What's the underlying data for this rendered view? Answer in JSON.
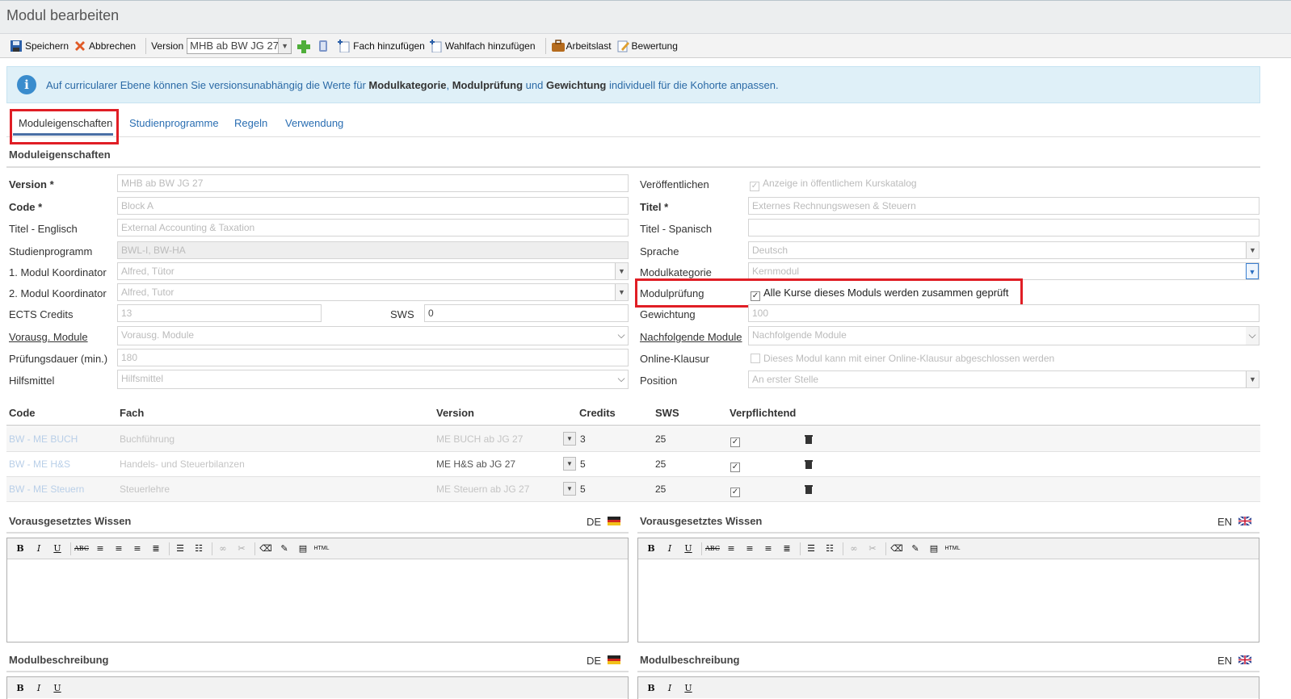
{
  "title": "Modul bearbeiten",
  "toolbar": {
    "save": "Speichern",
    "cancel": "Abbrechen",
    "version_label": "Version",
    "version_value": "MHB ab BW JG 27 √",
    "add_subject": "Fach hinzufügen",
    "add_elective": "Wahlfach hinzufügen",
    "workload": "Arbeitslast",
    "rating": "Bewertung"
  },
  "info": {
    "pre": "Auf curricularer Ebene können Sie versionsunabhängig die Werte für ",
    "b1": "Modulkategorie",
    "mid1": ", ",
    "b2": "Modulprüfung",
    "mid2": " und ",
    "b3": "Gewichtung",
    "post": " individuell für die Kohorte anpassen."
  },
  "tabs": [
    "Moduleigenschaften",
    "Studienprogramme",
    "Regeln",
    "Verwendung"
  ],
  "section_title": "Moduleigenschaften",
  "left": {
    "version_label": "Version *",
    "version_value": "MHB ab BW JG 27",
    "code_label": "Code *",
    "code_value": "Block A",
    "title_en_label": "Titel - Englisch",
    "title_en_value": "External Accounting & Taxation",
    "program_label": "Studienprogramm",
    "program_value": "BWL-I, BW-HA",
    "coord1_label": "1. Modul Koordinator",
    "coord1_value": "Alfred, Tütor",
    "coord2_label": "2. Modul Koordinator",
    "coord2_value": "Alfred, Tutor",
    "ects_label": "ECTS Credits",
    "ects_value": "13",
    "sws_label": "SWS",
    "sws_value": "0",
    "prereq_label": "Vorausg. Module",
    "prereq_value": "Vorausg. Module",
    "duration_label": "Prüfungsdauer (min.)",
    "duration_value": "180",
    "aids_label": "Hilfsmittel",
    "aids_value": "Hilfsmittel"
  },
  "right": {
    "publish_label": "Veröffentlichen",
    "publish_value": "Anzeige in öffentlichem Kurskatalog",
    "title_label": "Titel *",
    "title_value": "Externes Rechnungswesen & Steuern",
    "title_es_label": "Titel - Spanisch",
    "title_es_value": "",
    "lang_label": "Sprache",
    "lang_value": "Deutsch",
    "category_label": "Modulkategorie",
    "category_value": "Kernmodul",
    "exam_label": "Modulprüfung",
    "exam_value": "Alle Kurse dieses Moduls werden zusammen geprüft",
    "weight_label": "Gewichtung",
    "weight_value": "100",
    "next_label": "Nachfolgende Module",
    "next_value": "Nachfolgende Module",
    "online_label": "Online-Klausur",
    "online_value": "Dieses Modul kann mit einer Online-Klausur abgeschlossen werden",
    "position_label": "Position",
    "position_value": "An erster Stelle"
  },
  "table": {
    "headers": [
      "Code",
      "Fach",
      "Version",
      "Credits",
      "SWS",
      "Verpflichtend"
    ],
    "rows": [
      {
        "code": "BW - ME BUCH",
        "fach": "Buchführung",
        "version": "ME BUCH ab JG 27",
        "credits": "3",
        "sws": "25"
      },
      {
        "code": "BW - ME H&S",
        "fach": "Handels- und Steuerbilanzen",
        "version": "ME H&S ab JG 27",
        "credits": "5",
        "sws": "25"
      },
      {
        "code": "BW - ME Steuern",
        "fach": "Steuerlehre",
        "version": "ME Steuern ab JG 27",
        "credits": "5",
        "sws": "25"
      }
    ]
  },
  "editors": {
    "knowledge": "Vorausgesetztes Wissen",
    "description": "Modulbeschreibung",
    "de": "DE",
    "en": "EN",
    "html": "HTML"
  },
  "colors": {
    "accent": "#2a6eb2",
    "highlight": "#e01e25",
    "info_bg": "#dff0f8"
  }
}
